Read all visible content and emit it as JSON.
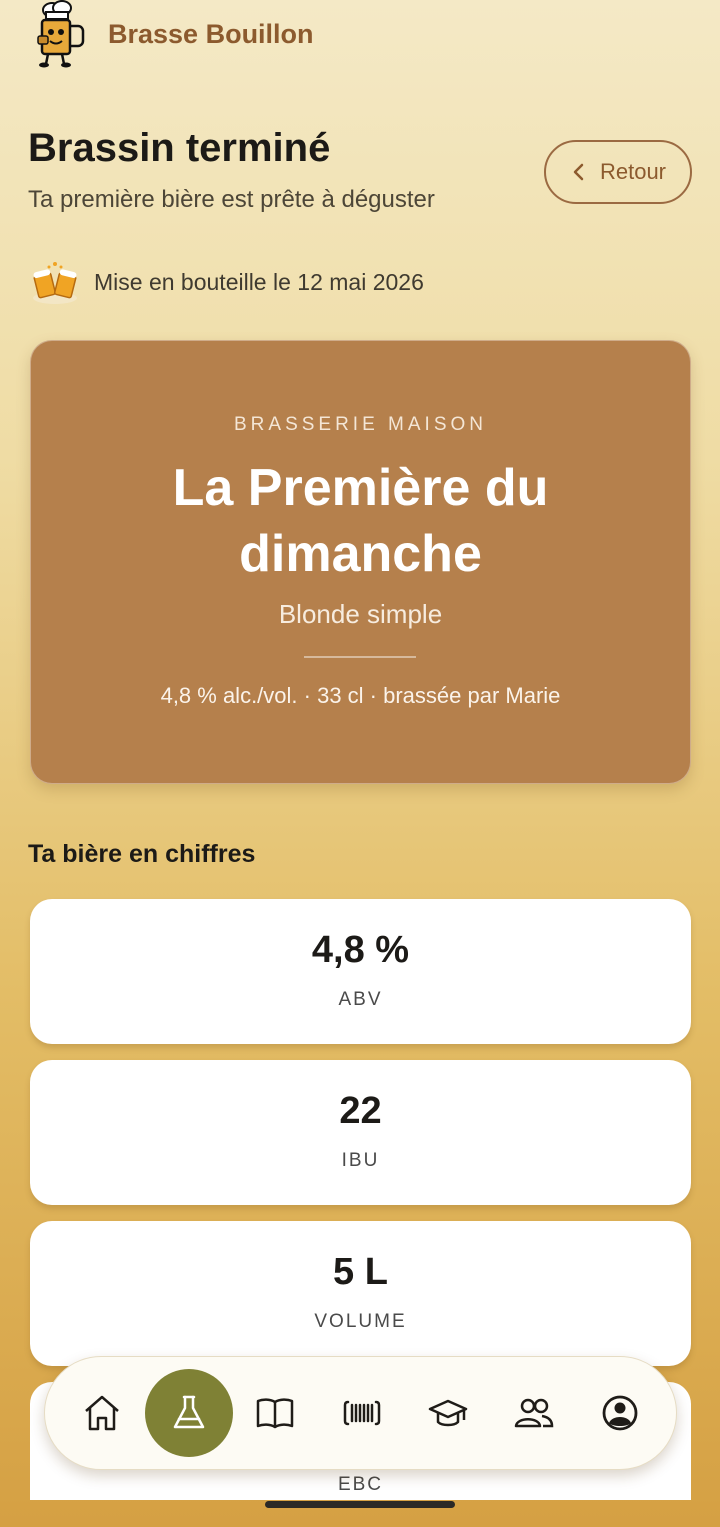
{
  "app": {
    "name": "Brasse Bouillon",
    "logo_icon": "chef-beer-mascot-icon"
  },
  "header": {
    "title": "Brassin terminé",
    "subtitle": "Ta première bière est prête à déguster",
    "back_label": "Retour"
  },
  "bottling": {
    "icon": "cheers-beer-icon",
    "text": "Mise en bouteille le 12 mai 2026"
  },
  "label": {
    "brewery": "BRASSERIE MAISON",
    "name": "La Première du dimanche",
    "style": "Blonde simple",
    "meta": "4,8 % alc./vol. · 33 cl · brassée par Marie",
    "color": "#b5804c"
  },
  "stats": {
    "title": "Ta bière en chiffres",
    "items": [
      {
        "value": "4,8 %",
        "label": "ABV"
      },
      {
        "value": "22",
        "label": "IBU"
      },
      {
        "value": "5 L",
        "label": "VOLUME"
      },
      {
        "value": "",
        "label": "EBC"
      }
    ]
  },
  "nav": {
    "items": [
      {
        "id": "home",
        "icon": "home-icon",
        "active": false
      },
      {
        "id": "brew",
        "icon": "flask-icon",
        "active": true
      },
      {
        "id": "recipes",
        "icon": "book-icon",
        "active": false
      },
      {
        "id": "scan",
        "icon": "barcode-scan-icon",
        "active": false
      },
      {
        "id": "learn",
        "icon": "graduation-cap-icon",
        "active": false
      },
      {
        "id": "community",
        "icon": "users-icon",
        "active": false
      },
      {
        "id": "profile",
        "icon": "user-circle-icon",
        "active": false
      }
    ],
    "active_color": "#7f8135"
  }
}
